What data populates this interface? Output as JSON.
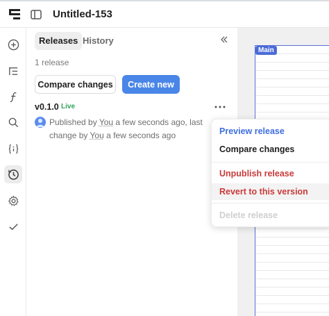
{
  "header": {
    "logo_icon": "framer-logo-icon",
    "panel_toggle_icon": "sidebar-toggle-icon",
    "title": "Untitled-153"
  },
  "rail": {
    "items": [
      {
        "icon": "plus-circle-icon",
        "active": false
      },
      {
        "icon": "layers-icon",
        "active": false
      },
      {
        "icon": "function-icon",
        "active": false
      },
      {
        "icon": "search-icon",
        "active": false
      },
      {
        "icon": "variables-icon",
        "active": false
      },
      {
        "icon": "history-clock-icon",
        "active": true
      },
      {
        "icon": "settings-icon",
        "active": false
      },
      {
        "icon": "checkmark-icon",
        "active": false
      }
    ]
  },
  "panel": {
    "tabs": [
      {
        "label": "Releases",
        "active": true
      },
      {
        "label": "History",
        "active": false
      }
    ],
    "collapse_icon": "double-chevron-left-icon",
    "release_count": "1 release",
    "compare_button": "Compare changes",
    "create_button": "Create new",
    "release": {
      "version": "v0.1.0",
      "badge": "Live",
      "meta_prefix": "Published by ",
      "meta_user1": "You",
      "meta_middle": " a few seconds ago, last change by ",
      "meta_user2": "You",
      "meta_suffix": " a few seconds ago"
    }
  },
  "canvas": {
    "artboard_label": "Main"
  },
  "context_menu": {
    "items": [
      {
        "label": "Preview release",
        "style": "blue"
      },
      {
        "label": "Compare changes",
        "style": "dark"
      },
      {
        "label": "Unpublish release",
        "style": "red"
      },
      {
        "label": "Revert to this version",
        "style": "red"
      },
      {
        "label": "Delete release",
        "style": "disabled"
      }
    ]
  },
  "colors": {
    "accent": "#4a86e8",
    "live": "#2fa35a",
    "danger": "#c93a3a",
    "artboard_border": "#5a6fd8"
  }
}
